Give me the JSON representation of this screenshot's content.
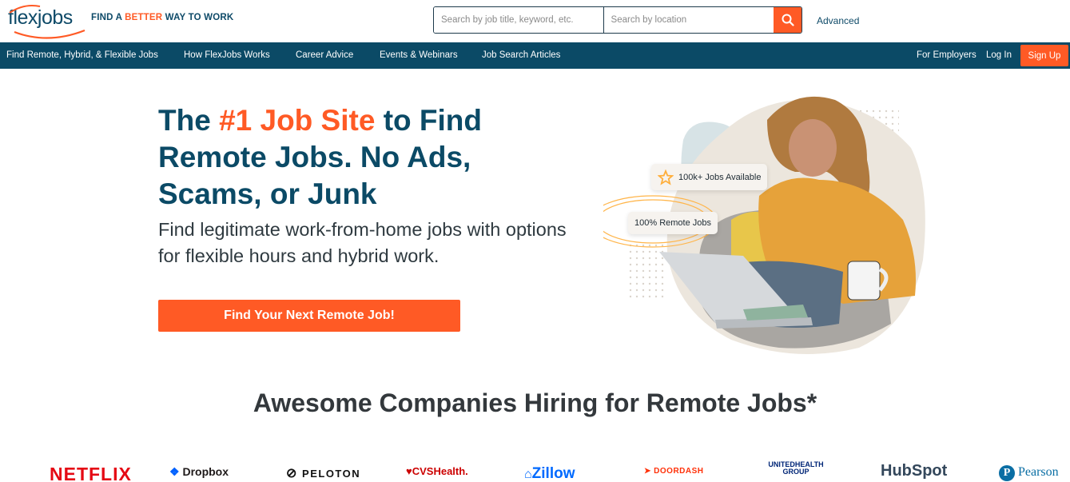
{
  "header": {
    "logo_text": "flexjobs",
    "tagline_pre": "FIND A ",
    "tagline_accent": "BETTER",
    "tagline_post": " WAY TO WORK",
    "search_keyword_placeholder": "Search by job title, keyword, etc.",
    "search_location_placeholder": "Search by location",
    "search_icon": "search-icon",
    "advanced_label": "Advanced"
  },
  "nav": {
    "items": [
      "Find Remote, Hybrid, & Flexible Jobs",
      "How FlexJobs Works",
      "Career Advice",
      "Events & Webinars",
      "Job Search Articles"
    ],
    "for_employers": "For Employers",
    "login": "Log In",
    "signup": "Sign Up"
  },
  "hero": {
    "title_pre": "The ",
    "title_highlight": "#1 Job Site",
    "title_post": " to Find Remote Jobs. No Ads, Scams, or Junk",
    "subtitle": "Find legitimate work-from-home jobs with options for flexible hours and hybrid work.",
    "cta": "Find Your Next Remote Job!",
    "badge_jobs": "100k+ Jobs Available",
    "badge_remote": "100% Remote Jobs"
  },
  "companies": {
    "title": "Awesome Companies Hiring for Remote Jobs*",
    "logos": [
      "NETFLIX",
      "Dropbox",
      "PELOTON",
      "CVSHealth.",
      "Zillow",
      "DOORDASH",
      "UNITEDHEALTH GROUP",
      "HubSpot",
      "Pearson"
    ]
  },
  "colors": {
    "brand_navy": "#0b4a66",
    "brand_orange": "#ff5a25"
  }
}
